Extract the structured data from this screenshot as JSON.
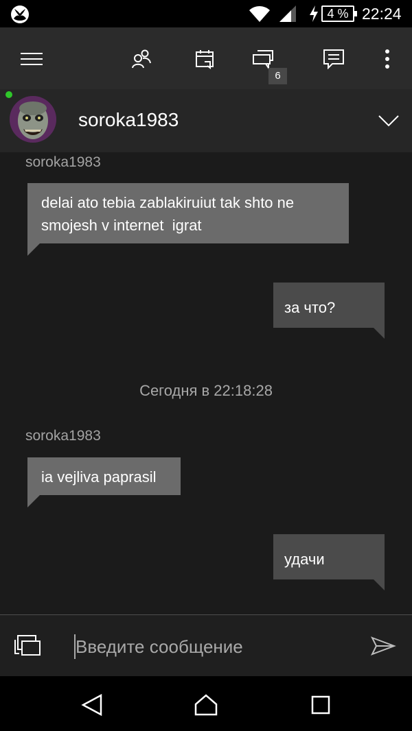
{
  "status_bar": {
    "battery": "4 %",
    "time": "22:24",
    "icons": [
      "xbox-logo-icon",
      "wifi-icon",
      "signal-icon",
      "charging-icon",
      "battery-icon"
    ]
  },
  "app_bar": {
    "icons": [
      "menu-icon",
      "friends-icon",
      "activity-icon",
      "conversations-icon",
      "messages-icon",
      "more-icon"
    ],
    "notification_count": "6"
  },
  "conversation": {
    "gamertag": "soroka1983",
    "online": true
  },
  "messages": [
    {
      "direction": "incoming",
      "sender": "soroka1983",
      "text_lines": [
        "delai ato tebia zablakiruiut tak shto ne",
        "smojesh v internet  igrat"
      ]
    },
    {
      "direction": "outgoing",
      "text": "за что?"
    },
    {
      "timestamp": "Сегодня в 22:18:28"
    },
    {
      "direction": "incoming",
      "sender": "soroka1983",
      "text": "ia vejliva paprasil"
    },
    {
      "direction": "outgoing",
      "text": "удачи"
    }
  ],
  "composer": {
    "placeholder": "Введите сообщение"
  },
  "colors": {
    "background": "#1b1b1b",
    "incoming_bubble": "#6b6b6b",
    "outgoing_bubble": "#4b4b4b",
    "presence_online": "#2fc72a"
  }
}
